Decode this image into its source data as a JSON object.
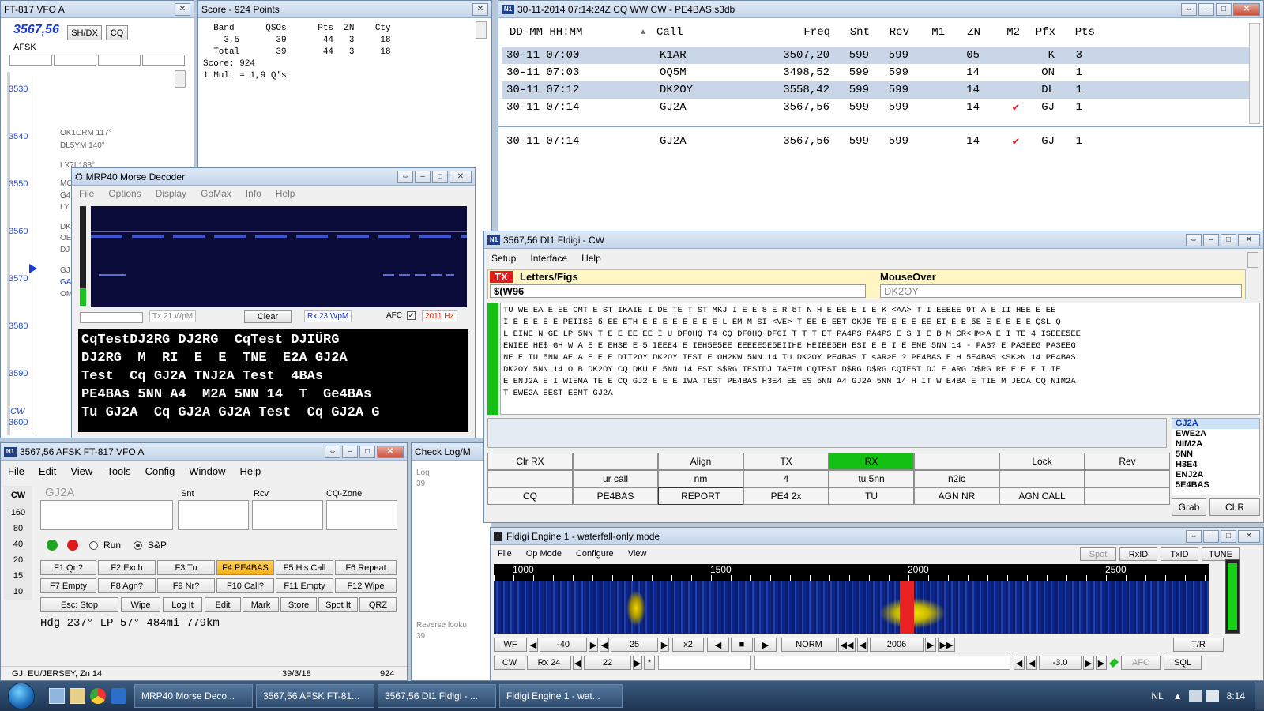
{
  "vfo": {
    "title": "FT-817 VFO A",
    "freq": "3567,56",
    "shdx": "SH/DX",
    "cq": "CQ",
    "mode": "AFSK",
    "scale": [
      "3530",
      "3540",
      "3550",
      "3560",
      "3570",
      "3580",
      "3590",
      "3600"
    ],
    "spots": [
      "OK1CRM 117°",
      "DL5YM 140°",
      "LX7I 188°"
    ],
    "side_labels": [
      "MO",
      "G4",
      "LY",
      "DK",
      "OE",
      "DJ",
      "GJ",
      "GA",
      "OM"
    ],
    "cw": "CW"
  },
  "score": {
    "title": "Score - 924 Points",
    "lines": [
      "  Band      QSOs      Pts  ZN    Cty",
      "    3,5       39       44   3     18",
      "  Total       39       44   3     18",
      "Score: 924",
      "1 Mult = 1,9 Q's"
    ]
  },
  "log": {
    "title": "30-11-2014 07:14:24Z  CQ WW CW - PE4BAS.s3db",
    "headers": [
      "DD-MM HH:MM",
      "Call",
      "Freq",
      "Snt",
      "Rcv",
      "M1",
      "ZN",
      "M2",
      "Pfx",
      "Pts"
    ],
    "rows": [
      {
        "dt": "30-11 07:00",
        "call": "K1AR",
        "freq": "3507,20",
        "snt": "599",
        "rcv": "599",
        "m1": "",
        "zn": "05",
        "m2": "",
        "pfx": "K",
        "pts": "3"
      },
      {
        "dt": "30-11 07:03",
        "call": "OQ5M",
        "freq": "3498,52",
        "snt": "599",
        "rcv": "599",
        "m1": "",
        "zn": "14",
        "m2": "",
        "pfx": "ON",
        "pts": "1"
      },
      {
        "dt": "30-11 07:12",
        "call": "DK2OY",
        "freq": "3558,42",
        "snt": "599",
        "rcv": "599",
        "m1": "",
        "zn": "14",
        "m2": "",
        "pfx": "DL",
        "pts": "1"
      },
      {
        "dt": "30-11 07:14",
        "call": "GJ2A",
        "freq": "3567,56",
        "snt": "599",
        "rcv": "599",
        "m1": "",
        "zn": "14",
        "m2": "✔",
        "pfx": "GJ",
        "pts": "1"
      }
    ],
    "current": {
      "dt": "30-11 07:14",
      "call": "GJ2A",
      "freq": "3567,56",
      "snt": "599",
      "rcv": "599",
      "m1": "",
      "zn": "14",
      "m2": "✔",
      "pfx": "GJ",
      "pts": "1"
    }
  },
  "mrp": {
    "title": "MRP40 Morse Decoder",
    "menu": [
      "File",
      "Options",
      "Display",
      "GoMax",
      "Info",
      "Help"
    ],
    "tx_wpm": "Tx 21 WpM",
    "clear": "Clear",
    "rx_wpm": "Rx 23 WpM",
    "afc": "AFC",
    "hz": "2011 Hz",
    "text": [
      "CqTestDJ2RG DJ2RG  CqTest DJIÜRG",
      "DJ2RG  M  RI  E  E  TNE  E2A GJ2A",
      "Test  Cq GJ2A TNJ2A Test  4BAs",
      "PE4BAs 5NN A4  M2A 5NN 14  T  Ge4BAs",
      "Tu GJ2A  Cq GJ2A GJ2A Test  Cq GJ2A G"
    ]
  },
  "entry": {
    "title": "3567,56 AFSK FT-817 VFO A",
    "menu": [
      "File",
      "Edit",
      "View",
      "Tools",
      "Config",
      "Window",
      "Help"
    ],
    "call_hint": "GJ2A",
    "snt": "Snt",
    "rcv": "Rcv",
    "zone": "CQ-Zone",
    "mode": "CW",
    "bands": [
      "160",
      "80",
      "40",
      "20",
      "15",
      "10"
    ],
    "run": "Run",
    "sp": "S&P",
    "fkeys": [
      "F1 Qrl?",
      "F2 Exch",
      "F3 Tu",
      "F4 PE4BAS",
      "F5 His Call",
      "F6 Repeat",
      "F7 Empty",
      "F8 Agn?",
      "F9 Nr?",
      "F10 Call?",
      "F11 Empty",
      "F12 Wipe"
    ],
    "bottom": [
      "Esc: Stop",
      "Wipe",
      "Log It",
      "Edit",
      "Mark",
      "Store",
      "Spot It",
      "QRZ"
    ],
    "heading": "Hdg 237°  LP 57°  484mi  779km",
    "status_left": "GJ: EU/JERSEY, Zn 14",
    "status_mid": "39/3/18",
    "status_right": "924"
  },
  "checklog": {
    "title": "Check Log/M",
    "log": "Log",
    "n": "39",
    "rev": "Reverse looku",
    "rev_n": "39"
  },
  "fldigi": {
    "title": "3567,56  DI1 Fldigi - CW",
    "menu": [
      "Setup",
      "Interface",
      "Help"
    ],
    "tx": "TX",
    "letters": "Letters/Figs",
    "mouseover": "MouseOver",
    "input": "$(W96",
    "mo_val": "DK2OY",
    "rx_lines": [
      "TU WE EA E EE CMT E ST IKAIE I DE TE T ST MKJ I E E 8 E R 5T N H E EE E I E K <AA> T I EEEEE 9T A E II HEE E EE",
      "I E E E E E PEIISE 5 EE ETH E E E E E E E E L EM M SI <VE> T EE E EET OKJE TE E E E EE EI E E 5E E E E E E QSL Q",
      "L EINE N GE LP 5NN T E E EE EE I U DF0HQ T4 CQ DF0HQ DF0I T T T ET PA4PS PA4PS E S I E B M CR<HM>A E I TE 4 ISEEE5EE",
      "ENIEE HE$ GH W A E E EHSE E 5 IEEE4 E IEH5E5EE EEEEE5E5EIIHE HEIEE5EH ESI E E I E ENE 5NN 14 - PA3? E PA3EEG PA3EEG",
      "NE E TU 5NN AE A E E E DIT2OY DK2OY TEST E OH2KW 5NN 14 TU DK2OY PE4BAS T <AR>E ? PE4BAS E H 5E4BAS <SK>N 14 PE4BAS",
      "DK2OY 5NN 14 O B DK2OY CQ DKU E 5NN 14 EST S$RG TESTDJ TAEIM CQTEST D$RG D$RG CQTEST DJ E ARG D$RG RE E E E I IE",
      "E ENJ2A E I WIEMA TE E CQ GJ2 E E E IWA TEST PE4BAS H3E4 EE ES 5NN A4 GJ2A 5NN 14 H IT W E4BA E TIE M JEOA CQ NIM2A",
      "T EWE2A EEST EEMT GJ2A"
    ],
    "calls": [
      "GJ2A",
      "EWE2A",
      "NIM2A",
      "5NN",
      "H3E4",
      "ENJ2A",
      "5E4BAS"
    ],
    "row1": [
      "Clr RX",
      "",
      "Align",
      "TX",
      "RX",
      "",
      "Lock",
      "Rev"
    ],
    "row2": [
      "",
      "ur call",
      "nm",
      "4",
      "tu 5nn",
      "n2ic",
      "",
      ""
    ],
    "row3": [
      "CQ",
      "PE4BAS",
      "REPORT",
      "PE4 2x",
      "TU",
      "AGN NR",
      "AGN CALL",
      ""
    ],
    "grab": "Grab",
    "clr": "CLR"
  },
  "wf": {
    "title": "Fldigi Engine 1 - waterfall-only mode",
    "menu": [
      "File",
      "Op Mode",
      "Configure",
      "View"
    ],
    "spot": "Spot",
    "rxid": "RxID",
    "txid": "TxID",
    "tune": "TUNE",
    "scale": [
      "1000",
      "1500",
      "2000",
      "2500"
    ],
    "ctrl": [
      "WF",
      "-40",
      "25",
      "x2",
      "NORM",
      "2006",
      "T/R"
    ],
    "ctrl2": [
      "CW",
      "Rx 24",
      "22",
      "*",
      "-3.0",
      "AFC",
      "SQL"
    ]
  },
  "taskbar": {
    "items": [
      "MRP40 Morse Deco...",
      "3567,56 AFSK FT-81...",
      "3567,56  DI1 Fldigi - ...",
      "Fldigi Engine 1 - wat..."
    ],
    "lang": "NL",
    "time": "8:14"
  }
}
